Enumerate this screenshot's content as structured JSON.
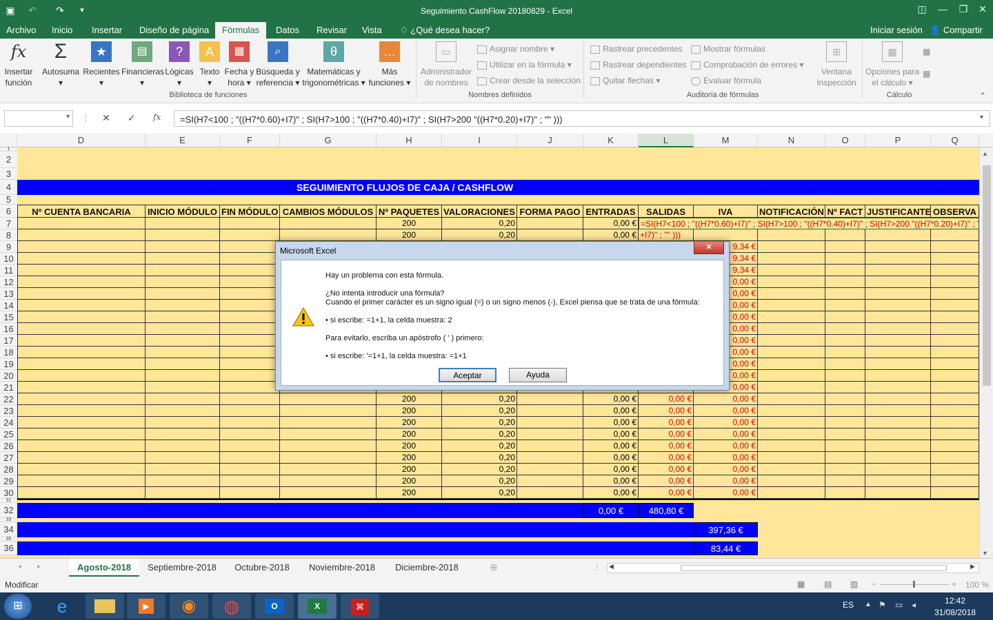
{
  "title_bar": {
    "title": "Seguimiento CashFlow 20180829 - Excel"
  },
  "menu": {
    "items": [
      "Archivo",
      "Inicio",
      "Insertar",
      "Diseño de página",
      "Fórmulas",
      "Datos",
      "Revisar",
      "Vista"
    ],
    "active": "Fórmulas",
    "tell_me": "¿Qué desea hacer?",
    "sign_in": "Iniciar sesión",
    "share": "Compartir"
  },
  "ribbon": {
    "insert_fn": [
      "Insertar",
      "función"
    ],
    "autosum": "Autosuma",
    "recent": "Recientes",
    "financial": "Financieras",
    "logical": "Lógicas",
    "text": "Texto",
    "datetime": [
      "Fecha y",
      "hora"
    ],
    "lookup": [
      "Búsqueda y",
      "referencia"
    ],
    "math": [
      "Matemáticas y",
      "trigonométricas"
    ],
    "more": [
      "Más",
      "funciones"
    ],
    "group_library": "Biblioteca de funciones",
    "name_manager": [
      "Administrador",
      "de nombres"
    ],
    "define_name": "Asignar nombre",
    "use_in_formula": "Utilizar en la fórmula",
    "create_from_sel": "Crear desde la selección",
    "group_names": "Nombres definidos",
    "trace_precedents": "Rastrear precedentes",
    "trace_dependents": "Rastrear dependientes",
    "remove_arrows": "Quitar flechas",
    "show_formulas": "Mostrar fórmulas",
    "error_checking": "Comprobación de errores",
    "evaluate": "Evaluar fórmula",
    "group_audit": "Auditoría de fórmulas",
    "watch": [
      "Ventana",
      "Inspección"
    ],
    "calc_options": [
      "Opciones para",
      "el cálculo"
    ],
    "group_calc": "Cálculo"
  },
  "formula_bar": {
    "name_box": "",
    "fx": "fx",
    "formula": "=SI(H7<100 ; \"((H7*0.60)+I7)\" ; SI(H7>100 ; \"((H7*0.40)+I7)\" ; SI(H7>200 \"((H7*0.20)+I7)\" ; \"\" )))"
  },
  "columns": [
    "D",
    "E",
    "F",
    "G",
    "H",
    "I",
    "J",
    "K",
    "L",
    "M",
    "N",
    "O",
    "P",
    "Q"
  ],
  "sheet": {
    "banner": "SEGUIMIENTO FLUJOS DE CAJA / CASHFLOW",
    "headers": [
      "Nº CUENTA BANCARIA",
      "INICIO MÓDULO",
      "FIN MÓDULO",
      "CAMBIOS MÓDULOS",
      "Nº PAQUETES",
      "VALORACIONES",
      "FORMA PAGO",
      "ENTRADAS",
      "SALIDAS",
      "IVA",
      "NOTIFICACIÓN",
      "Nº FACT",
      "JUSTIFICANTE",
      "OBSERVA"
    ],
    "editing_cell": "=SI(H7<100 ; \"((H7*0.60)+I7)\" ; SI(H7>100 ; \"((H7*0.40)+I7)\" ; SI(H7>200 \"((H7*0.20)+I7)\" ; \"\" )))",
    "editing_cell_wrap": "+I7)\" ; \"\" )))",
    "rows": [
      {
        "row": "7",
        "paquetes": "200",
        "valor": "0,20",
        "entradas": "0,00 €",
        "salidas": "",
        "iva": ""
      },
      {
        "row": "8",
        "paquetes": "200",
        "valor": "0,20",
        "entradas": "0,00 €",
        "salidas": "",
        "iva": ""
      },
      {
        "row": "9",
        "paquetes": "",
        "valor": "",
        "entradas": "",
        "salidas": "",
        "iva": "9,34 €"
      },
      {
        "row": "10",
        "paquetes": "",
        "valor": "",
        "entradas": "",
        "salidas": "",
        "iva": "9,34 €"
      },
      {
        "row": "11",
        "paquetes": "",
        "valor": "",
        "entradas": "",
        "salidas": "",
        "iva": "9,34 €"
      },
      {
        "row": "12",
        "paquetes": "",
        "valor": "",
        "entradas": "",
        "salidas": "",
        "iva": "0,00 €"
      },
      {
        "row": "13",
        "paquetes": "",
        "valor": "",
        "entradas": "",
        "salidas": "",
        "iva": "0,00 €"
      },
      {
        "row": "14",
        "paquetes": "",
        "valor": "",
        "entradas": "",
        "salidas": "",
        "iva": "0,00 €"
      },
      {
        "row": "15",
        "paquetes": "",
        "valor": "",
        "entradas": "",
        "salidas": "",
        "iva": "0,00 €"
      },
      {
        "row": "16",
        "paquetes": "",
        "valor": "",
        "entradas": "",
        "salidas": "",
        "iva": "0,00 €"
      },
      {
        "row": "17",
        "paquetes": "",
        "valor": "",
        "entradas": "",
        "salidas": "",
        "iva": "0,00 €"
      },
      {
        "row": "18",
        "paquetes": "",
        "valor": "",
        "entradas": "",
        "salidas": "",
        "iva": "0,00 €"
      },
      {
        "row": "19",
        "paquetes": "",
        "valor": "",
        "entradas": "",
        "salidas": "",
        "iva": "0,00 €"
      },
      {
        "row": "20",
        "paquetes": "",
        "valor": "",
        "entradas": "",
        "salidas": "",
        "iva": "0,00 €"
      },
      {
        "row": "21",
        "paquetes": "",
        "valor": "",
        "entradas": "",
        "salidas": "",
        "iva": "0,00 €"
      },
      {
        "row": "22",
        "paquetes": "200",
        "valor": "0,20",
        "entradas": "0,00 €",
        "salidas": "0,00 €",
        "iva": "0,00 €"
      },
      {
        "row": "23",
        "paquetes": "200",
        "valor": "0,20",
        "entradas": "0,00 €",
        "salidas": "0,00 €",
        "iva": "0,00 €"
      },
      {
        "row": "24",
        "paquetes": "200",
        "valor": "0,20",
        "entradas": "0,00 €",
        "salidas": "0,00 €",
        "iva": "0,00 €"
      },
      {
        "row": "25",
        "paquetes": "200",
        "valor": "0,20",
        "entradas": "0,00 €",
        "salidas": "0,00 €",
        "iva": "0,00 €"
      },
      {
        "row": "26",
        "paquetes": "200",
        "valor": "0,20",
        "entradas": "0,00 €",
        "salidas": "0,00 €",
        "iva": "0,00 €"
      },
      {
        "row": "27",
        "paquetes": "200",
        "valor": "0,20",
        "entradas": "0,00 €",
        "salidas": "0,00 €",
        "iva": "0,00 €"
      },
      {
        "row": "28",
        "paquetes": "200",
        "valor": "0,20",
        "entradas": "0,00 €",
        "salidas": "0,00 €",
        "iva": "0,00 €"
      },
      {
        "row": "29",
        "paquetes": "200",
        "valor": "0,20",
        "entradas": "0,00 €",
        "salidas": "0,00 €",
        "iva": "0,00 €"
      },
      {
        "row": "30",
        "paquetes": "200",
        "valor": "0,20",
        "entradas": "0,00 €",
        "salidas": "0,00 €",
        "iva": "0,00 €"
      }
    ],
    "total_entradas": "0,00 €",
    "total_salidas": "480,80 €",
    "total_iva": "397,36 €",
    "total_extra": "83,44 €"
  },
  "dialog": {
    "title": "Microsoft Excel",
    "close": "✕",
    "line1": "Hay un problema con esta fórmula.",
    "line2": "¿No intenta introducir una fórmula?",
    "line3": "Cuando el primer carácter es un signo igual (=) o un signo menos (-), Excel piensa que se trata de una fórmula:",
    "line4": "• si escribe:   =1+1, la celda muestra:   2",
    "line5": "Para evitarlo, escriba un apóstrofo ( ' ) primero:",
    "line6": "• si escribe:   '=1+1, la celda muestra:   =1+1",
    "ok": "Aceptar",
    "help": "Ayuda"
  },
  "tabs": [
    "Agosto-2018",
    "Septiembre-2018",
    "Octubre-2018",
    "Noviembre-2018",
    "Diciembre-2018"
  ],
  "active_tab": "Agosto-2018",
  "status": {
    "mode": "Modificar",
    "zoom": "100 %"
  },
  "taskbar": {
    "lang": "ES",
    "time": "12:42",
    "date": "31/08/2018"
  },
  "colors": {
    "excel_green": "#217346",
    "sheet_fill": "#ffe699",
    "banner_blue": "#0000ff",
    "error_red": "#e00000"
  }
}
